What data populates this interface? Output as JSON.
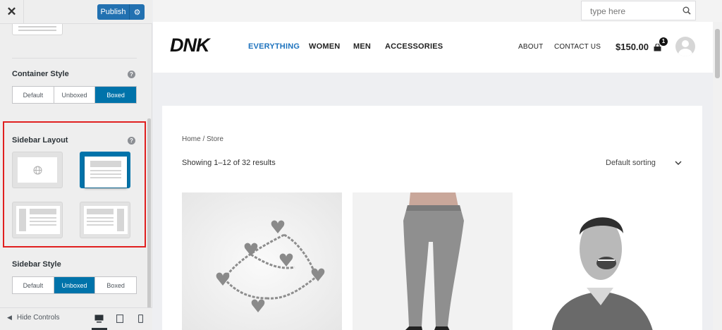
{
  "panel": {
    "close_icon": "close-icon",
    "publish_label": "Publish",
    "container_style": {
      "title": "Container Style",
      "options": [
        "Default",
        "Unboxed",
        "Boxed"
      ],
      "selected": "Boxed"
    },
    "sidebar_layout": {
      "title": "Sidebar Layout",
      "options": [
        "no-sidebar",
        "full-width",
        "left-sidebar",
        "right-sidebar"
      ],
      "selected": "full-width"
    },
    "sidebar_style": {
      "title": "Sidebar Style",
      "options": [
        "Default",
        "Unboxed",
        "Boxed"
      ],
      "selected": "Unboxed"
    },
    "footer": {
      "hide_controls": "Hide Controls",
      "devices": [
        "desktop",
        "tablet",
        "mobile"
      ],
      "selected_device": "desktop"
    }
  },
  "site": {
    "search_placeholder": "type here",
    "logo": "DNK",
    "nav": [
      "EVERYTHING",
      "WOMEN",
      "MEN",
      "ACCESSORIES"
    ],
    "nav_active": "EVERYTHING",
    "secondary_nav": [
      "ABOUT",
      "CONTACT US"
    ],
    "cart_total": "$150.00",
    "cart_count": "1",
    "breadcrumb": "Home / Store",
    "results": "Showing 1–12 of 32 results",
    "sorting": "Default sorting",
    "products": [
      "heart-charm-bracelet",
      "grey-skinny-jeans",
      "laughing-man-shirt"
    ]
  },
  "colors": {
    "accent": "#2271b1",
    "toggle_active": "#0073aa",
    "nav_active": "#1e73be",
    "highlight_box": "#e02020"
  }
}
